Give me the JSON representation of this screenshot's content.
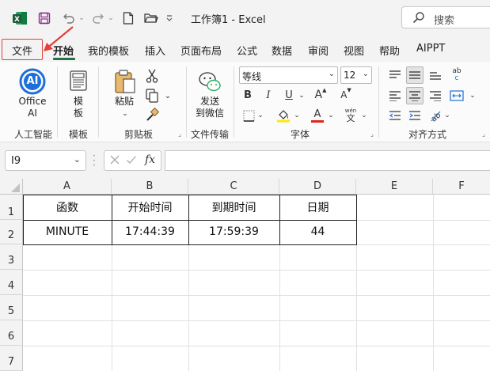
{
  "titlebar": {
    "title": "工作簿1  -  Excel",
    "search_placeholder": "搜索",
    "icons": [
      "excel-logo-icon",
      "save-icon",
      "undo-icon",
      "redo-icon",
      "new-file-icon",
      "open-folder-icon",
      "customize-qat-icon",
      "search-icon"
    ]
  },
  "menu": {
    "tabs": [
      {
        "id": "file",
        "label": "文件"
      },
      {
        "id": "home",
        "label": "开始"
      },
      {
        "id": "templates",
        "label": "我的模板"
      },
      {
        "id": "insert",
        "label": "插入"
      },
      {
        "id": "layout",
        "label": "页面布局"
      },
      {
        "id": "formulas",
        "label": "公式"
      },
      {
        "id": "data",
        "label": "数据"
      },
      {
        "id": "review",
        "label": "审阅"
      },
      {
        "id": "view",
        "label": "视图"
      },
      {
        "id": "help",
        "label": "帮助"
      },
      {
        "id": "aippt",
        "label": "AIPPT"
      }
    ],
    "active_tab": "开始",
    "highlight_color": "#e0413a",
    "accent_color": "#217346"
  },
  "ribbon": {
    "office_ai": {
      "line1": "Office",
      "line2": "AI",
      "badge": "AI",
      "group": "人工智能"
    },
    "template": {
      "line1": "模",
      "line2": "板",
      "group": "模板"
    },
    "clipboard": {
      "paste": "粘贴",
      "group": "剪贴板"
    },
    "file_transfer": {
      "line1": "发送",
      "line2": "到微信",
      "group": "文件传输"
    },
    "font": {
      "name": "等线",
      "size": "12",
      "bold": "B",
      "italic": "I",
      "underline": "U",
      "grow": "A",
      "shrink": "A",
      "color_letter": "A",
      "wen_top": "wén",
      "wen_bottom": "文",
      "group": "字体"
    },
    "alignment": {
      "group": "对齐方式",
      "wrap_top": "ab",
      "wrap_bottom": "c"
    }
  },
  "formula_bar": {
    "name_box": "I9",
    "fx": "fx",
    "formula": ""
  },
  "sheet": {
    "columns": [
      "A",
      "B",
      "C",
      "D",
      "E",
      "F"
    ],
    "rows": [
      "1",
      "2",
      "3",
      "4",
      "5",
      "6",
      "7"
    ],
    "header": [
      "函数",
      "开始时间",
      "到期时间",
      "日期"
    ],
    "data": [
      "MINUTE",
      "17:44:39",
      "17:59:39",
      "44"
    ]
  }
}
